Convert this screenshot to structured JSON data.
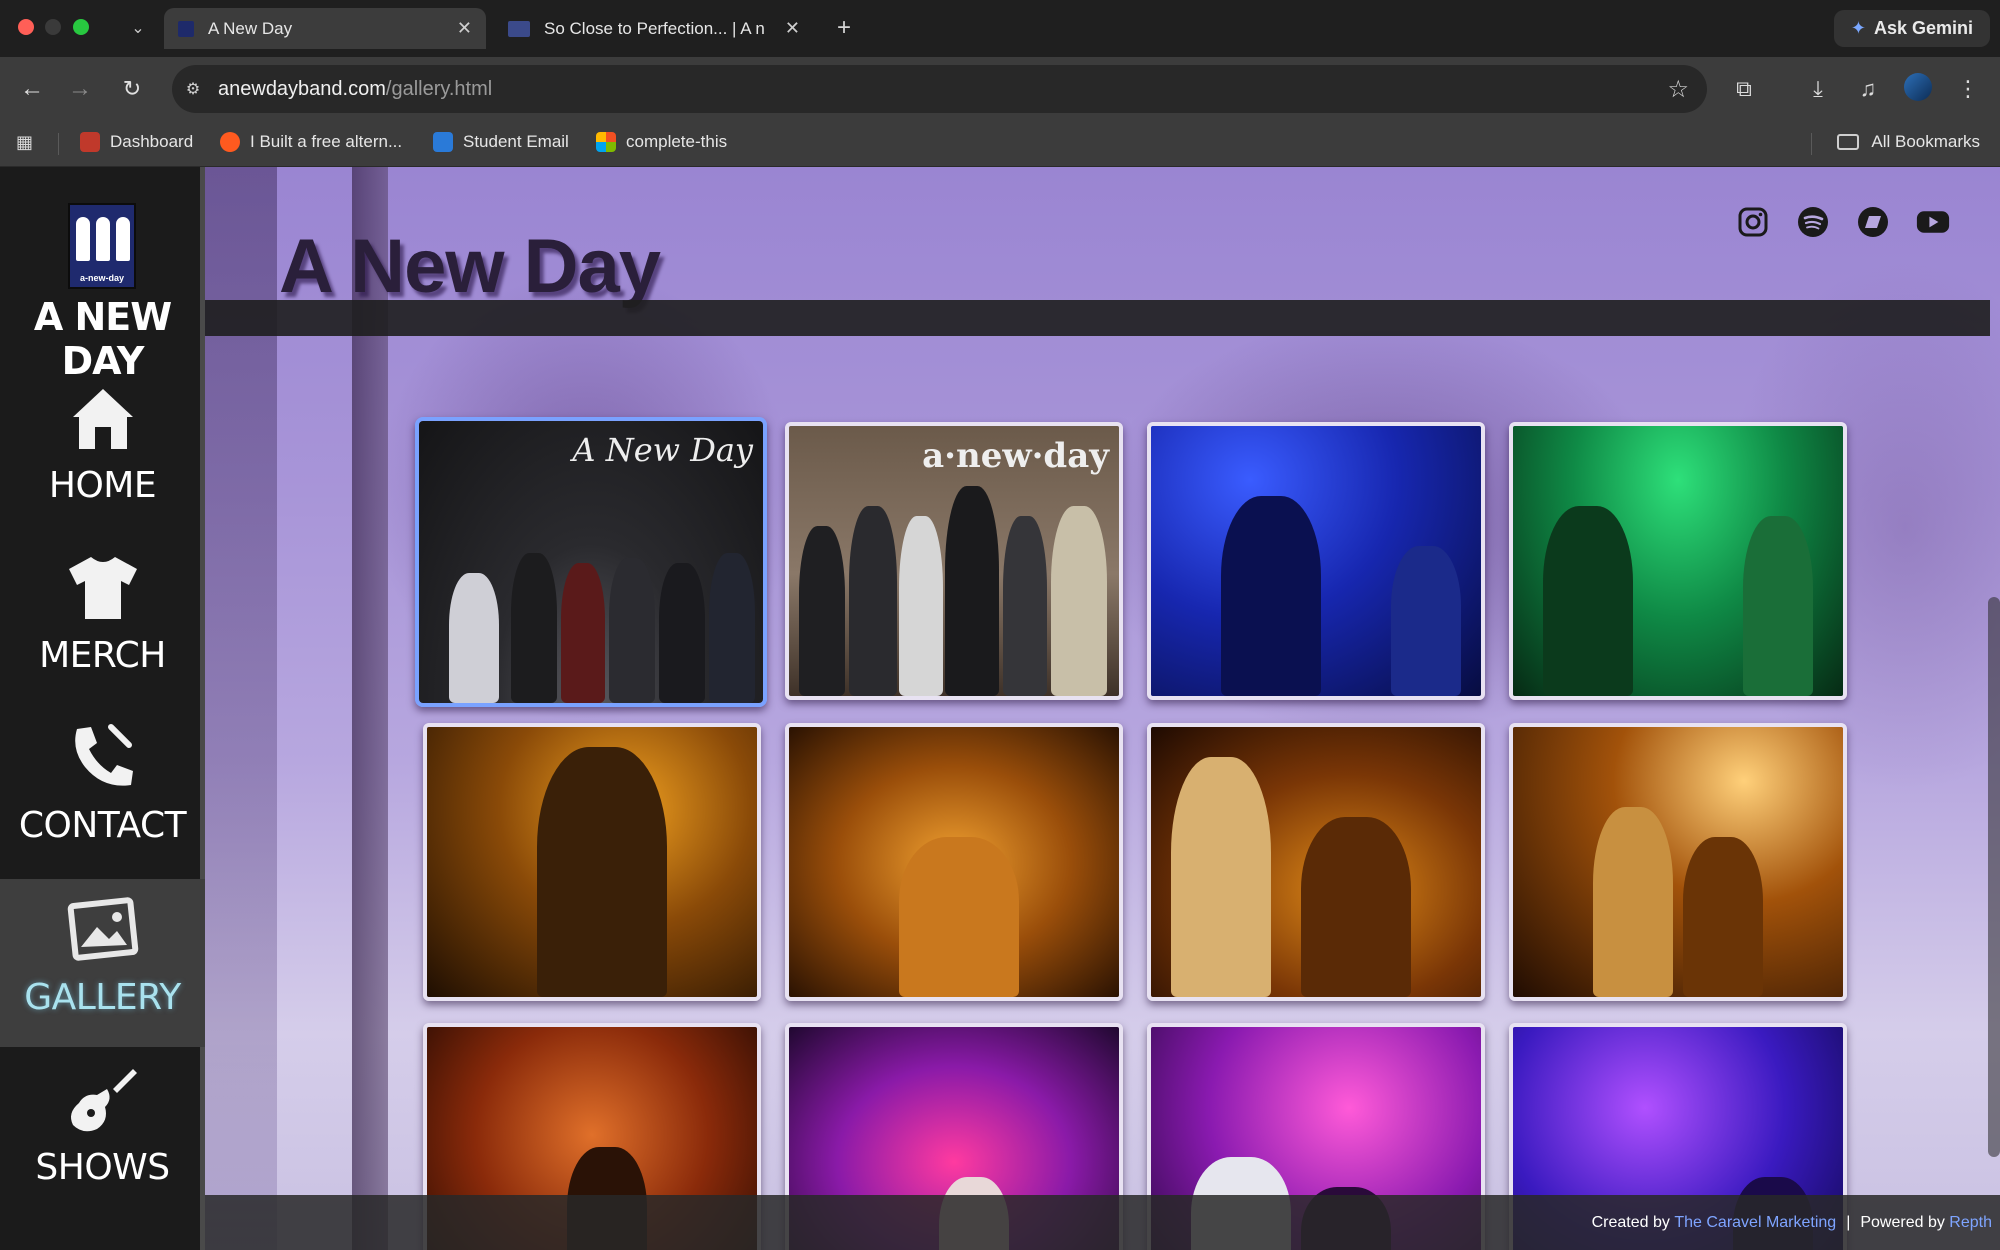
{
  "browser": {
    "tabs": [
      {
        "title": "A New Day",
        "active": true
      },
      {
        "title": "So Close to Perfection... | A n",
        "active": false
      }
    ],
    "ask_gemini": "Ask Gemini",
    "url_domain": "anewdayband.com",
    "url_path": "/gallery.html",
    "bookmarks": [
      {
        "label": "Dashboard",
        "color": "#c0392b"
      },
      {
        "label": "I Built a free altern...",
        "color": "#ff5a1f"
      },
      {
        "label": "Student Email",
        "color": "#2a7ad8"
      },
      {
        "label": "complete-this",
        "color": "#7fba00"
      }
    ],
    "all_bookmarks": "All Bookmarks"
  },
  "sidebar": {
    "brand_name": "A NEW DAY",
    "logo_caption": "a-new-day",
    "items": [
      {
        "label": "HOME",
        "icon": "home-icon",
        "active": false
      },
      {
        "label": "MERCH",
        "icon": "tshirt-icon",
        "active": false
      },
      {
        "label": "CONTACT",
        "icon": "phone-icon",
        "active": false
      },
      {
        "label": "GALLERY",
        "icon": "picture-icon",
        "active": true
      },
      {
        "label": "SHOWS",
        "icon": "guitar-icon",
        "active": false
      }
    ]
  },
  "header": {
    "title": "A New Day",
    "socials": [
      "instagram-icon",
      "spotify-icon",
      "bandcamp-icon",
      "youtube-icon"
    ]
  },
  "gallery": {
    "watermark_script": "A New Day",
    "watermark_plain": "a·new·day",
    "photos": [
      {
        "scene": "night-group",
        "selected": true
      },
      {
        "scene": "indoor-group",
        "selected": false
      },
      {
        "scene": "blue-stage",
        "selected": false
      },
      {
        "scene": "green-stage",
        "selected": false
      },
      {
        "scene": "orange-guitarist",
        "selected": false
      },
      {
        "scene": "orange-drummer",
        "selected": false
      },
      {
        "scene": "orange-bassist",
        "selected": false
      },
      {
        "scene": "orange-band",
        "selected": false
      },
      {
        "scene": "red-band",
        "selected": false
      },
      {
        "scene": "purple-band",
        "selected": false
      },
      {
        "scene": "purple-singer",
        "selected": false
      },
      {
        "scene": "blue-purple-band",
        "selected": false
      }
    ]
  },
  "footer": {
    "created_by": "Created by",
    "creator": "The Caravel Marketing",
    "divider": "|",
    "powered_by": "Powered by",
    "platform": "Repth"
  }
}
